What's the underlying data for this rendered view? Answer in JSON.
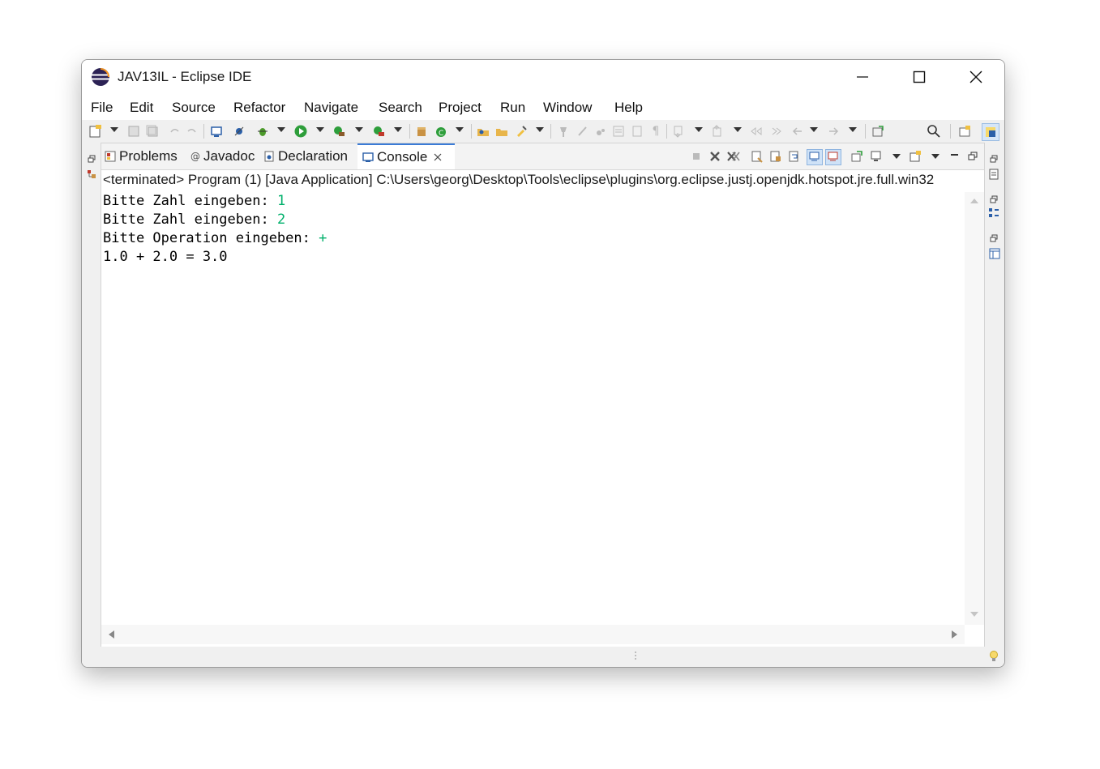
{
  "window": {
    "title": "JAV13IL - Eclipse IDE"
  },
  "menu": [
    "File",
    "Edit",
    "Source",
    "Refactor",
    "Navigate",
    "Search",
    "Project",
    "Run",
    "Window",
    "Help"
  ],
  "tabs": [
    {
      "label": "Problems",
      "icon": "problems-icon"
    },
    {
      "label": "Javadoc",
      "icon": "javadoc-icon"
    },
    {
      "label": "Declaration",
      "icon": "declaration-icon"
    },
    {
      "label": "Console",
      "icon": "console-icon",
      "active": true
    }
  ],
  "console": {
    "launch": "<terminated> Program (1) [Java Application] C:\\Users\\georg\\Desktop\\Tools\\eclipse\\plugins\\org.eclipse.justj.openjdk.hotspot.jre.full.win32",
    "lines": [
      {
        "prompt": "Bitte Zahl eingeben: ",
        "input": "1"
      },
      {
        "prompt": "Bitte Zahl eingeben: ",
        "input": "2"
      },
      {
        "prompt": "Bitte Operation eingeben: ",
        "input": "+"
      },
      {
        "prompt": "1.0 + 2.0 = 3.0",
        "input": ""
      }
    ]
  },
  "colors": {
    "input_text": "#00b06b",
    "active_tab_accent": "#3b7bd6"
  }
}
